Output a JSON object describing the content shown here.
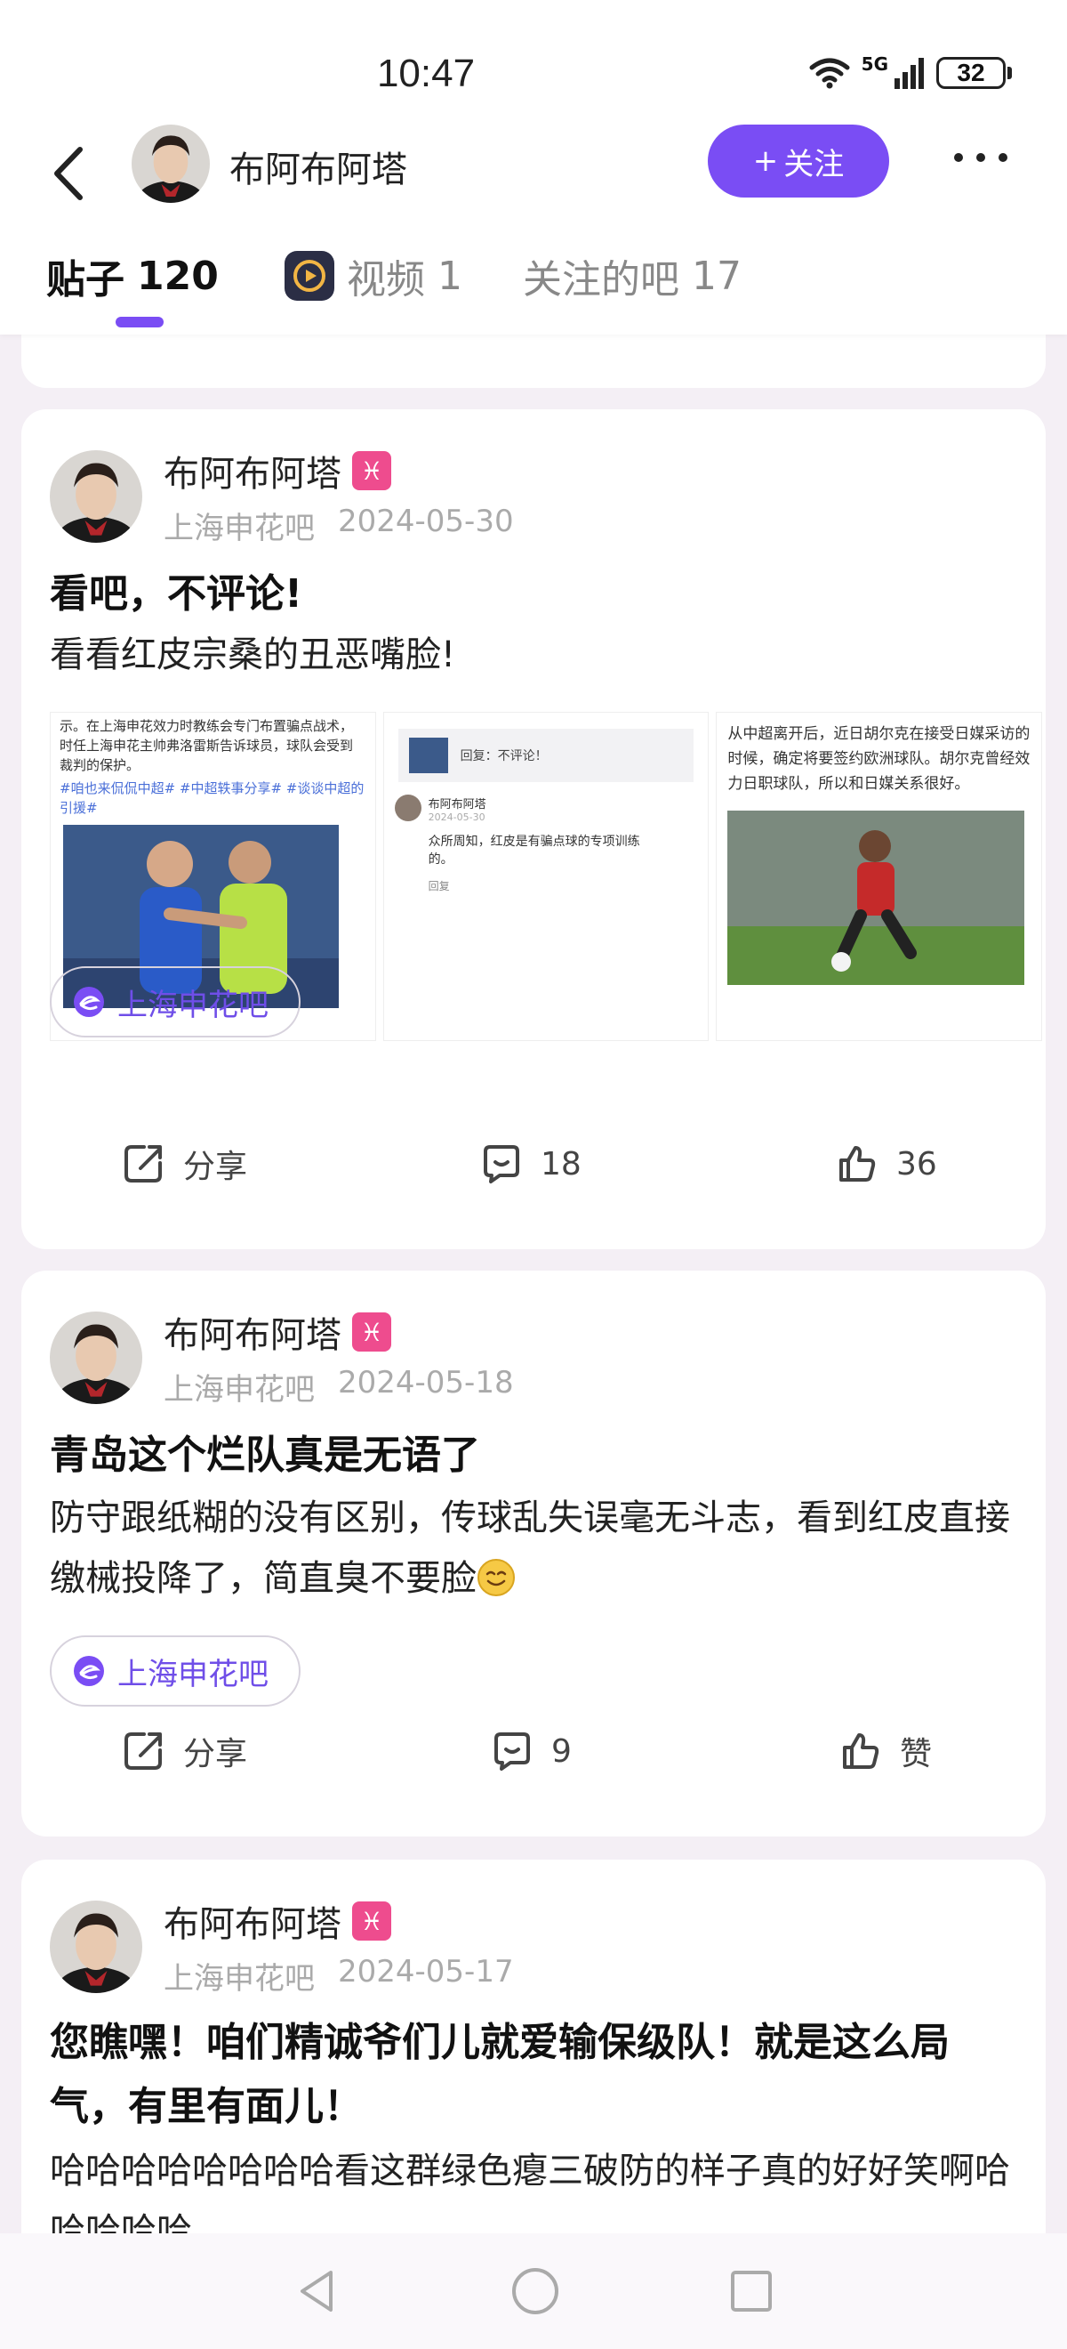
{
  "status": {
    "time": "10:47",
    "signal": "5G",
    "battery": "32"
  },
  "header": {
    "name": "布阿布阿塔",
    "follow_label": "关注",
    "follow_plus": "+"
  },
  "tabs": [
    {
      "label": "贴子",
      "count": "120"
    },
    {
      "label": "视频",
      "count": "1"
    },
    {
      "label": "关注的吧",
      "count": "17"
    }
  ],
  "posts": [
    {
      "author": "布阿布阿塔",
      "zodiac": "♓",
      "forum": "上海申花吧",
      "date": "2024-05-30",
      "title": "看吧，不评论!",
      "body": "看看红皮宗桑的丑恶嘴脸!",
      "images": {
        "tile1_text": "示。在上海申花效力时教练会专门布置骗点战术，时任上海申花主帅弗洛雷斯告诉球员，球队会受到裁判的保护。",
        "tile1_tags": "#咱也来侃侃中超# #中超轶事分享# #谈谈中超的引援#",
        "tile2_reply_title": "回复：不评论！",
        "tile2_name": "布阿布阿塔",
        "tile2_date": "2024-05-30",
        "tile2_text": "众所周知，红皮是有骗点球的专项训练的。",
        "tile2_reply": "回复",
        "tile3_text": "从中超离开后，近日胡尔克在接受日媒采访的时候，确定将要签约欧洲球队。胡尔克曾经效力日职球队，所以和日媒关系很好。"
      },
      "share_label": "分享",
      "comments": "18",
      "likes": "36"
    },
    {
      "author": "布阿布阿塔",
      "zodiac": "♓",
      "forum": "上海申花吧",
      "date": "2024-05-18",
      "title": "青岛这个烂队真是无语了",
      "body": "防守跟纸糊的没有区别，传球乱失误毫无斗志，看到红皮直接缴械投降了，简直臭不要脸",
      "share_label": "分享",
      "comments": "9",
      "likes": "赞"
    },
    {
      "author": "布阿布阿塔",
      "zodiac": "♓",
      "forum": "上海申花吧",
      "date": "2024-05-17",
      "title": "您瞧嘿！咱们精诚爷们儿就爱输保级队！就是这么局气，有里有面儿！",
      "body": "哈哈哈哈哈哈哈哈看这群绿色瘪三破防的样子真的好好笑啊哈哈哈哈哈"
    }
  ]
}
